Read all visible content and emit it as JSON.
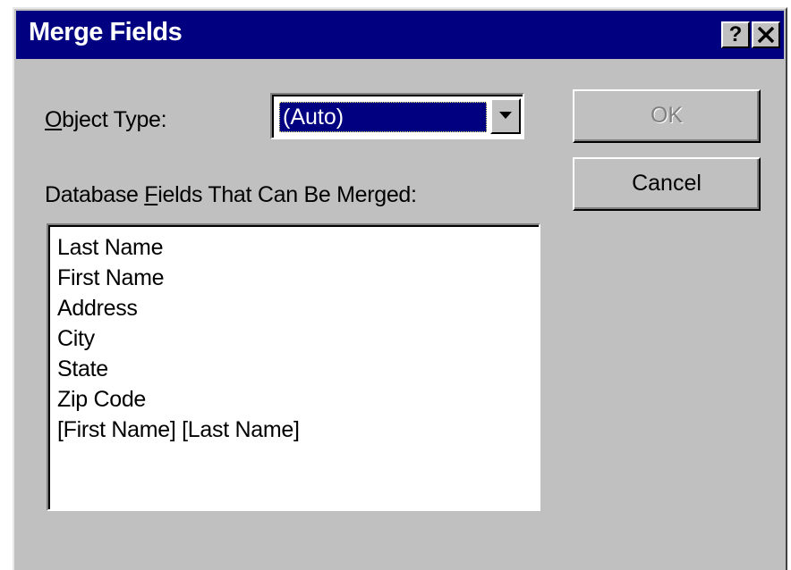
{
  "window": {
    "title": "Merge Fields",
    "help_glyph": "?",
    "close_icon": "close-icon"
  },
  "object_type": {
    "label_mnemonic": "O",
    "label_rest": "bject Type:",
    "value": "(Auto)",
    "arrow_icon": "dropdown-arrow-icon"
  },
  "fields": {
    "label_before": "Database ",
    "label_mnemonic": "F",
    "label_after": "ields That Can Be Merged:",
    "items": [
      "Last Name",
      "First Name",
      "Address",
      "City",
      "State",
      "Zip Code",
      "[First Name] [Last Name]"
    ]
  },
  "buttons": {
    "ok_label": "OK",
    "ok_enabled": false,
    "cancel_label": "Cancel"
  },
  "colors": {
    "title_bar": "#000080",
    "face": "#c0c0c0",
    "selection": "#000080"
  }
}
